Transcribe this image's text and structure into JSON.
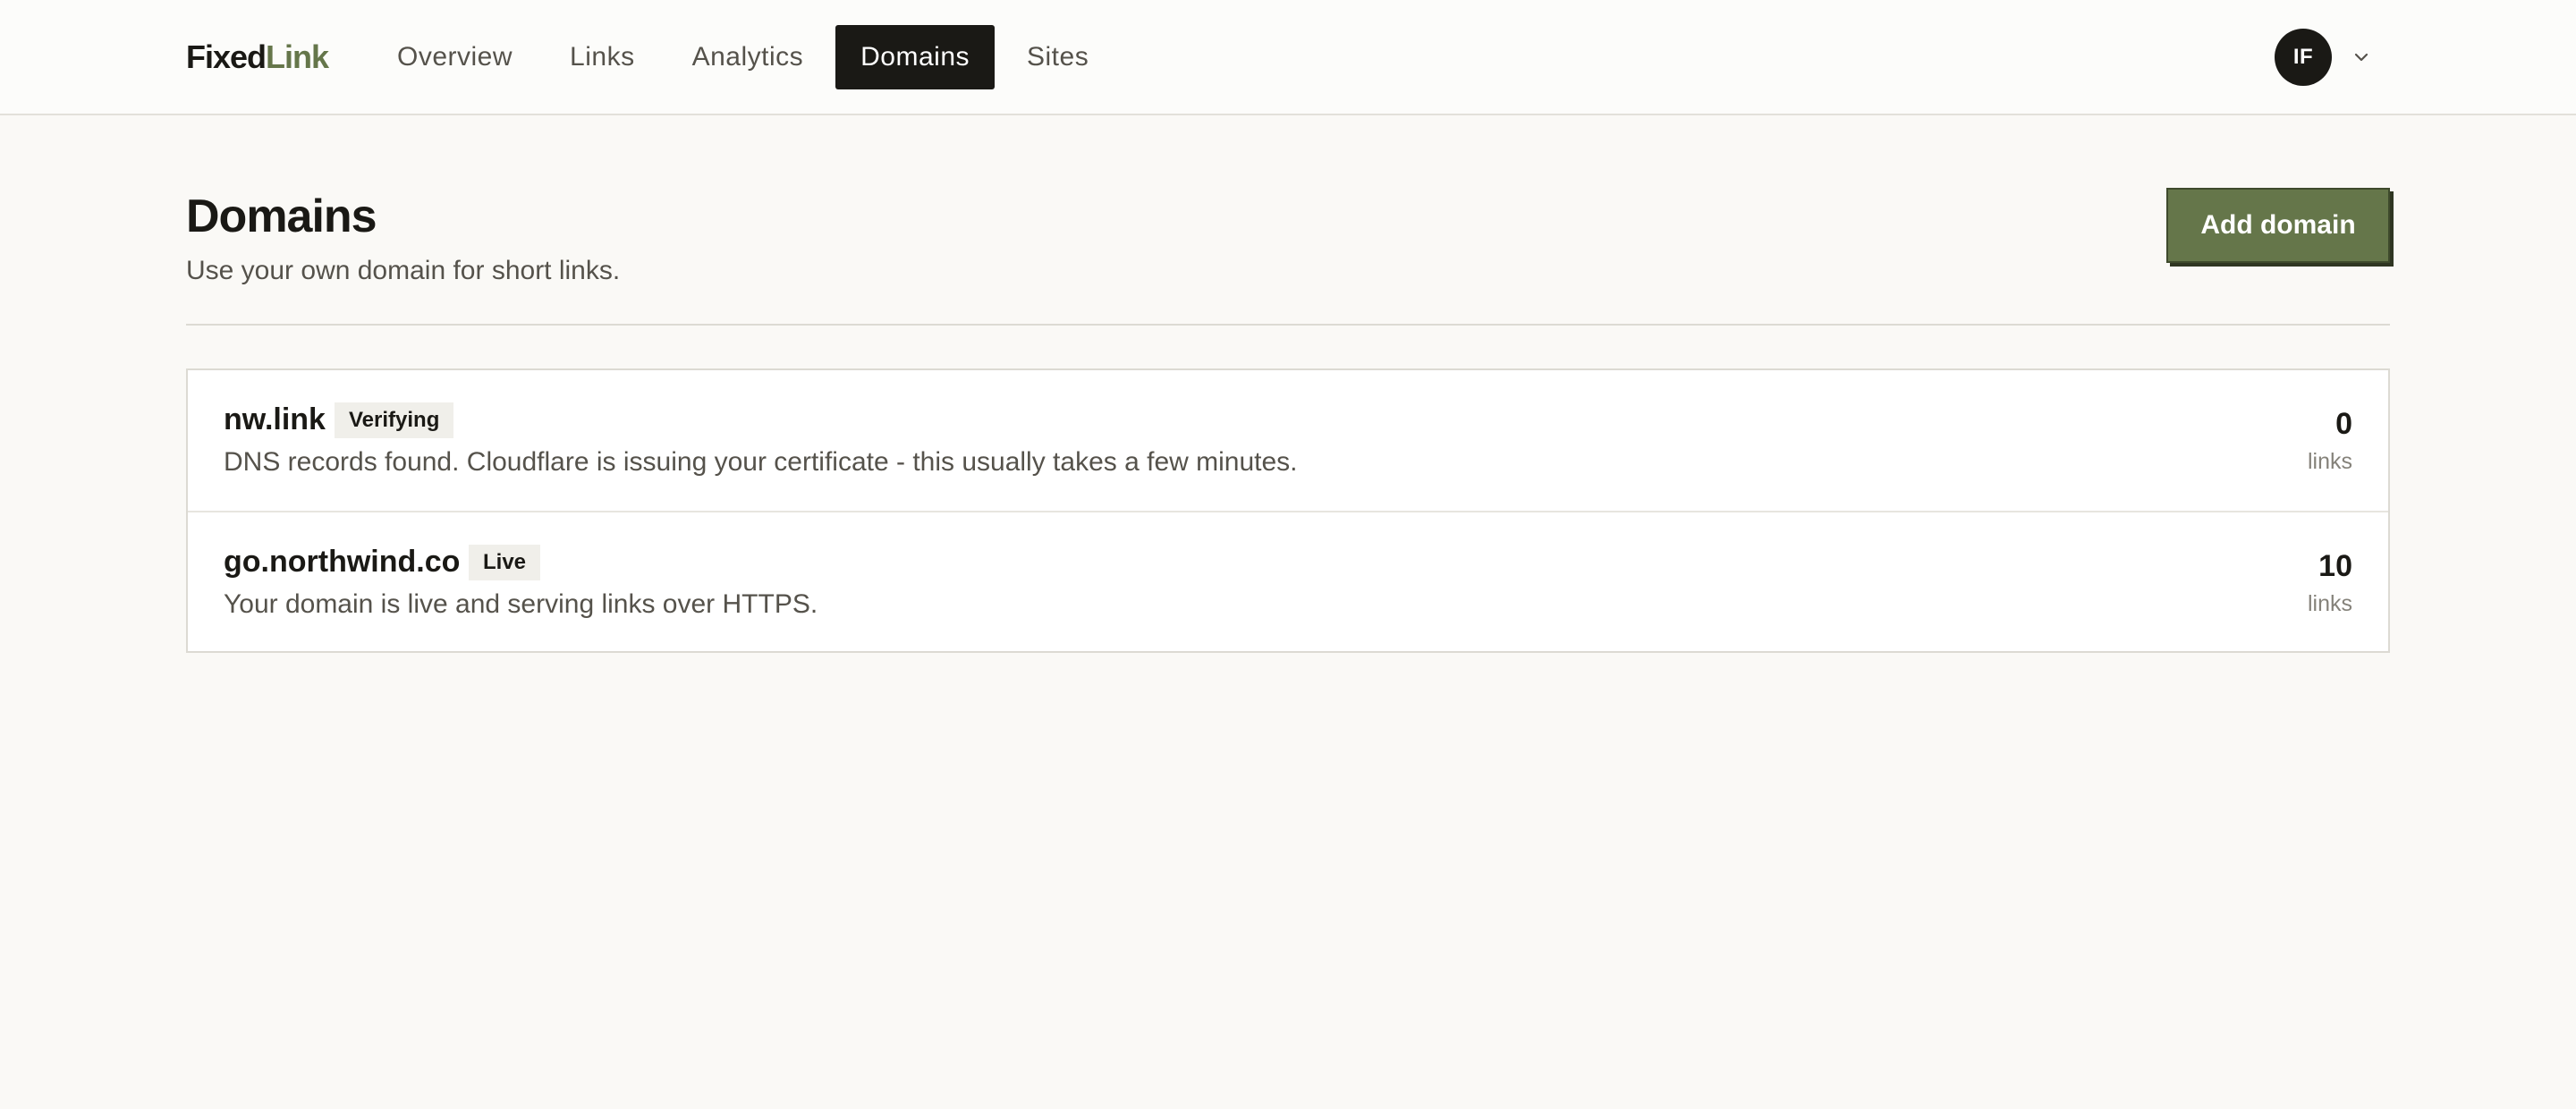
{
  "brand": {
    "part1": "Fixed",
    "part2": "Link",
    "accent_color": "#65764a"
  },
  "nav": {
    "items": [
      {
        "label": "Overview",
        "active": false
      },
      {
        "label": "Links",
        "active": false
      },
      {
        "label": "Analytics",
        "active": false
      },
      {
        "label": "Domains",
        "active": true
      },
      {
        "label": "Sites",
        "active": false
      }
    ]
  },
  "user": {
    "initials": "IF",
    "menu_icon": "chevron-down-icon"
  },
  "page": {
    "title": "Domains",
    "subtitle": "Use your own domain for short links.",
    "add_button_label": "Add domain"
  },
  "domains": [
    {
      "name": "nw.link",
      "status": "Verifying",
      "description": "DNS records found. Cloudflare is issuing your certificate - this usually takes a few minutes.",
      "link_count": "0",
      "count_label": "links"
    },
    {
      "name": "go.northwind.co",
      "status": "Live",
      "description": "Your domain is live and serving links over HTTPS.",
      "link_count": "10",
      "count_label": "links"
    }
  ]
}
